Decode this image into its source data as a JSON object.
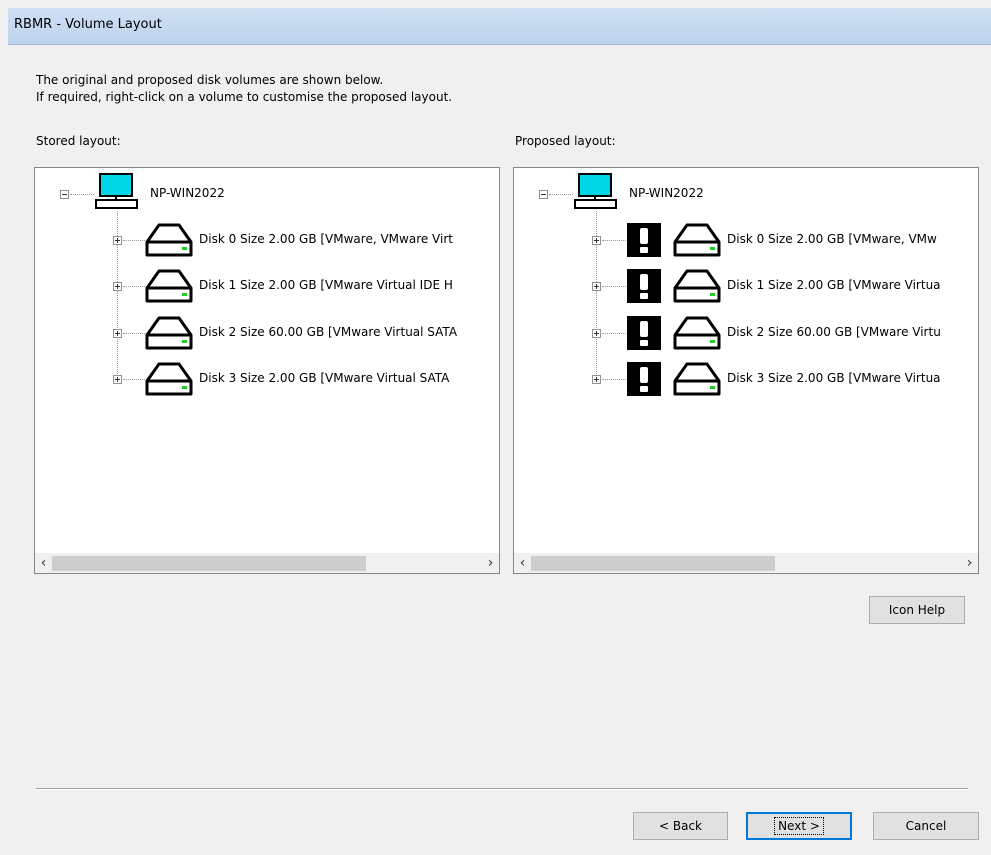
{
  "window": {
    "title": "RBMR - Volume Layout"
  },
  "intro": {
    "line1": "The original and proposed disk volumes are shown below.",
    "line2": "If required, right-click on a volume to customise the proposed layout."
  },
  "stored": {
    "label": "Stored layout:",
    "root": "NP-WIN2022",
    "disks": [
      "Disk 0 Size  2.00 GB [VMware, VMware Virt",
      "Disk 1 Size  2.00 GB [VMware Virtual IDE H",
      "Disk 2 Size 60.00 GB [VMware Virtual SATA",
      "Disk 3 Size  2.00 GB [VMware Virtual SATA"
    ]
  },
  "proposed": {
    "label": "Proposed layout:",
    "root": "NP-WIN2022",
    "disks": [
      "Disk 0 Size  2.00 GB [VMware,  VMw",
      "Disk 1 Size  2.00 GB [VMware Virtua",
      "Disk 2 Size 60.00 GB [VMware Virtu",
      "Disk 3 Size  2.00 GB [VMware Virtua"
    ]
  },
  "scroll": {
    "left": "‹",
    "right": "›"
  },
  "buttons": {
    "icon_help": "Icon Help",
    "back": "< Back",
    "next": "Next >",
    "cancel": "Cancel"
  },
  "icons": {
    "computer": "computer-icon",
    "disk": "hard-disk-icon",
    "warning": "exclamation-warning-icon"
  },
  "colors": {
    "title_bar": "#c4d8ef",
    "screen": "#00d7e6",
    "disk_led": "#1fd11f",
    "default_button_border": "#0078d7"
  }
}
